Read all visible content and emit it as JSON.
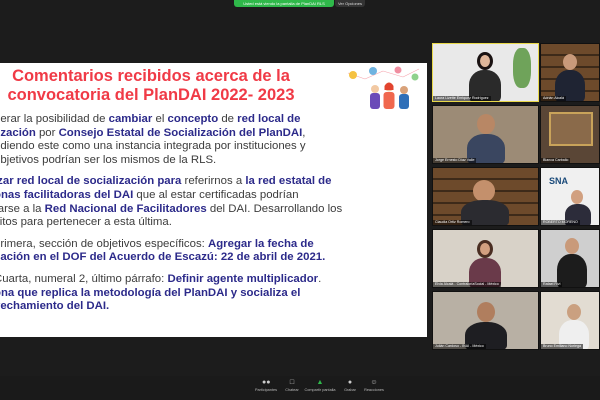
{
  "share_banner": {
    "text": "Usted está viendo la pantalla de PlanDAI RLS",
    "stop": "Ver Opciones"
  },
  "slide": {
    "title": "Comentarios recibidos acerca de la convocatoria del PlanDAI 2022- 2023",
    "p1": [
      [
        "derar la posibilidad de ",
        "cambiar",
        " el ",
        "concepto",
        " de ",
        "red local de"
      ],
      [
        "lización",
        " por ",
        "Consejo Estatal de Socialización del PlanDAI",
        ","
      ],
      [
        "ndiendo este como una instancia integrada por instituciones y"
      ],
      [
        "objetivos podrían ser los mismos de la RLS."
      ]
    ],
    "p2": [
      [
        "izar red local de socialización para",
        " referirnos a ",
        "la red estatal de"
      ],
      [
        "onas facilitadoras del DAI",
        " que al estar certificadas podrían"
      ],
      [
        "rarse a la ",
        "Red Nacional de Facilitadores",
        " del DAI. Desarrollando los"
      ],
      [
        "sitos para pertenecer a esta última."
      ]
    ],
    "p3": [
      [
        " primera, sección de objetivos específicos: ",
        "Agregar la fecha de"
      ],
      [
        "cación en el DOF del Acuerdo de Escazú",
        ": 22 de abril de 2021."
      ]
    ],
    "p4": [
      [
        " Cuarta, numeral 2, último párrafo: ",
        "Definir agente multiplicador",
        "."
      ],
      [
        "ona que replica la metodología del PlanDAI y socializa el"
      ],
      [
        "vechamiento del DAI."
      ]
    ]
  },
  "participants": [
    {
      "name": "Laura Lizette Enriquez Rodríguez",
      "active": true
    },
    {
      "name": "Adrián Alcalá"
    },
    {
      "name": "Jorge Ernesto Díaz Valle"
    },
    {
      "name": "Blanca Carballo"
    },
    {
      "name": "Claudia Ortiz Romero"
    },
    {
      "name": "ROBERTO MORENO"
    },
    {
      "name": "Elvia Alcalá - ContraloríaSocial - México"
    },
    {
      "name": "Rafael Rivi"
    },
    {
      "name": "Julián Cardoso - INAI - México"
    },
    {
      "name": "Bruno Emiliano Noriega"
    }
  ],
  "sna_logo": "SNA",
  "toolbar": {
    "items": [
      {
        "label": "Participantes",
        "icon": "participants-icon"
      },
      {
        "label": "Chatear",
        "icon": "chat-icon"
      },
      {
        "label": "Compartir pantalla",
        "icon": "share-screen-icon"
      },
      {
        "label": "Grabar",
        "icon": "record-icon"
      },
      {
        "label": "Reacciones",
        "icon": "reactions-icon"
      }
    ],
    "participants_count": "64"
  },
  "colors": {
    "title": "#f03a46",
    "highlight": "#2c2a8a",
    "share_green": "#2fb84a"
  }
}
